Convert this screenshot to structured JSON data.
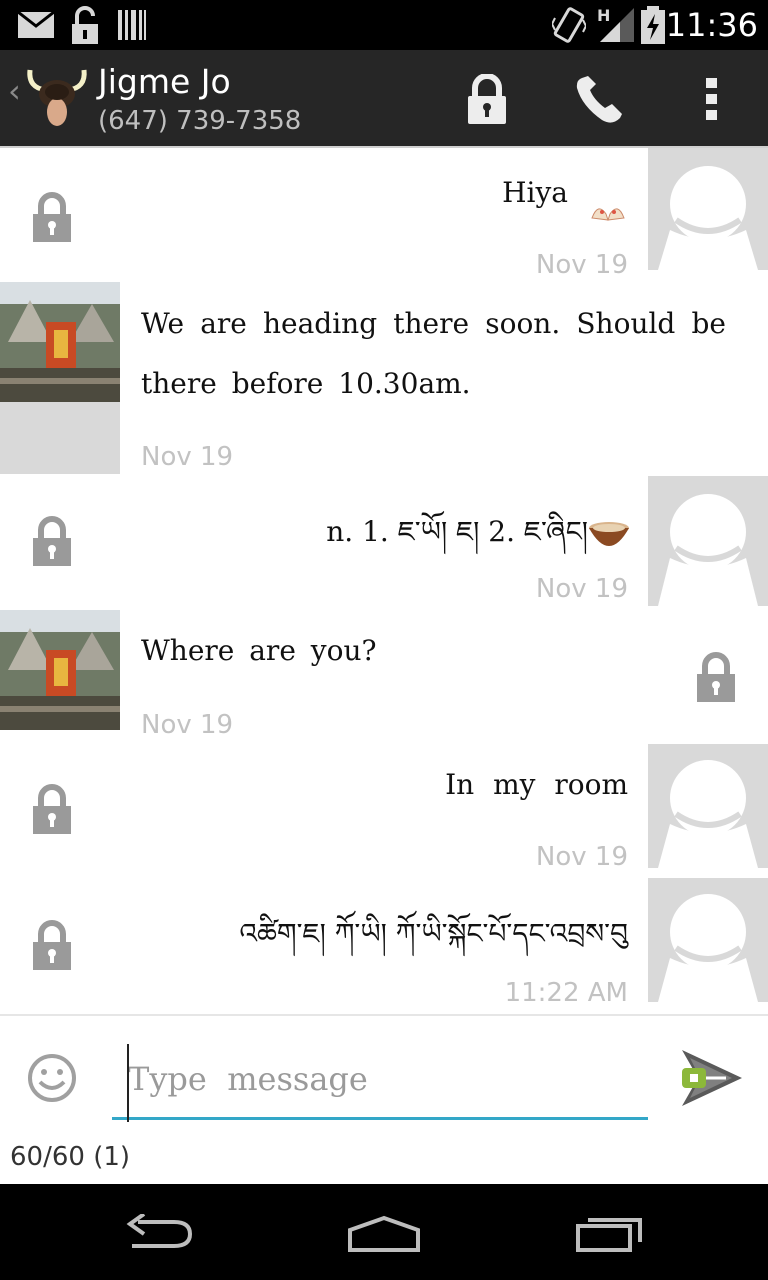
{
  "status_bar": {
    "time": "11:36",
    "network_type": "H"
  },
  "action_bar": {
    "contact_name": "Jigme Jo",
    "contact_phone": "(647) 739-7358"
  },
  "messages": [
    {
      "side": "sent",
      "text": "Hiya",
      "date": "Nov 19",
      "emoji": "praying-hands-icon"
    },
    {
      "side": "received",
      "text": "We are heading there soon. Should be there before 10.30am.",
      "date": "Nov 19"
    },
    {
      "side": "sent",
      "text": "n. 1. ཇ་ཡོ། ཇ། 2. ཇ་ཞིང།",
      "date": "Nov 19",
      "emoji": "tea-bowl-icon"
    },
    {
      "side": "received",
      "text": "Where are you?",
      "date": "Nov 19"
    },
    {
      "side": "sent",
      "text": "In my room",
      "date": "Nov 19"
    },
    {
      "side": "sent",
      "text": "འཚིག་ཇ། ཀོ་ཡི། ཀོ་ཡི་སྐོང་པོ་དང་འབྲས་བུ",
      "date": "11:22 AM"
    }
  ],
  "compose": {
    "placeholder": "Type  message",
    "value": "",
    "counter": "60/60 (1)"
  },
  "colors": {
    "accent": "#33a7c8",
    "action_bar": "#262626",
    "status_bar": "#000000",
    "date_text": "#c2c2c2",
    "avatar_placeholder": "#d9d9d9"
  }
}
